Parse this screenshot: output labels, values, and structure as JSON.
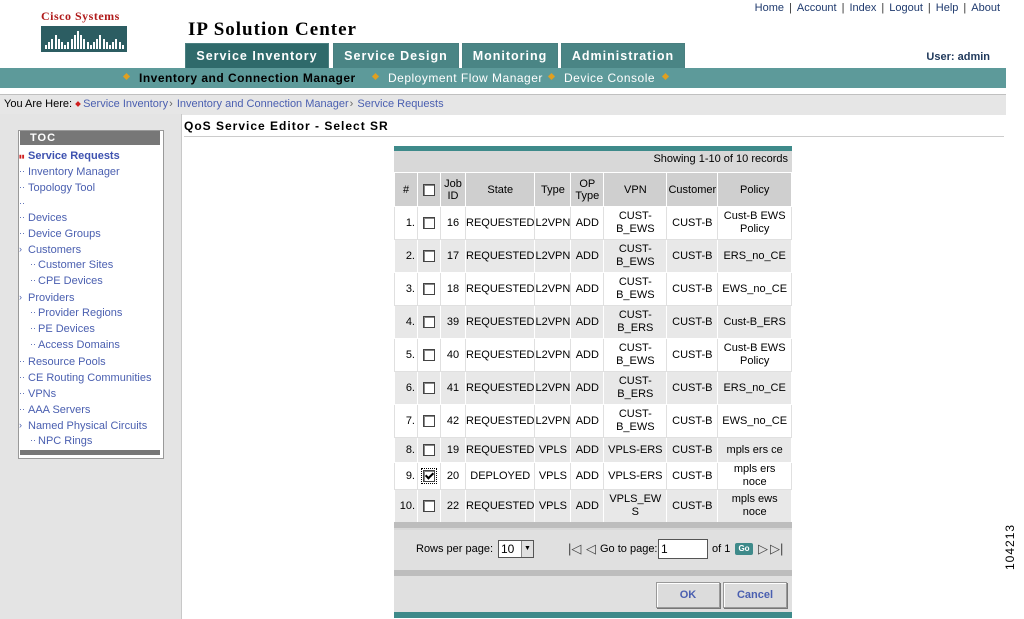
{
  "brand": {
    "logo_text": "Cisco Systems",
    "app_title": "IP Solution Center"
  },
  "top_links": [
    "Home",
    "Account",
    "Index",
    "Logout",
    "Help",
    "About"
  ],
  "user": {
    "label": "User: admin"
  },
  "tabs": [
    {
      "label": "Service Inventory",
      "active": true
    },
    {
      "label": "Service Design",
      "active": false
    },
    {
      "label": "Monitoring",
      "active": false
    },
    {
      "label": "Administration",
      "active": false
    }
  ],
  "subnav": [
    {
      "label": "Inventory and Connection Manager",
      "active": true
    },
    {
      "label": "Deployment Flow Manager",
      "active": false
    },
    {
      "label": "Device Console",
      "active": false
    }
  ],
  "breadcrumb": {
    "prefix": "You Are Here:",
    "items": [
      "Service Inventory",
      "Inventory and Connection Manager",
      "Service Requests"
    ]
  },
  "toc": {
    "title": "TOC",
    "items": [
      {
        "label": "Service Requests",
        "active": true
      },
      {
        "label": "Inventory Manager"
      },
      {
        "label": "Topology Tool"
      },
      {
        "label": ""
      },
      {
        "label": "Devices"
      },
      {
        "label": "Device Groups"
      },
      {
        "label": "Customers"
      },
      {
        "label": "Customer Sites"
      },
      {
        "label": "CPE Devices"
      },
      {
        "label": "Providers"
      },
      {
        "label": "Provider Regions"
      },
      {
        "label": "PE Devices"
      },
      {
        "label": "Access Domains"
      },
      {
        "label": "Resource Pools"
      },
      {
        "label": "CE Routing Communities"
      },
      {
        "label": "VPNs"
      },
      {
        "label": "AAA Servers"
      },
      {
        "label": "Named Physical Circuits"
      },
      {
        "label": "NPC Rings"
      }
    ]
  },
  "main": {
    "title": "QoS Service Editor - Select SR",
    "records_text": "Showing 1-10 of 10 records",
    "columns": [
      "#",
      "",
      "Job ID",
      "State",
      "Type",
      "OP Type",
      "VPN",
      "Customer",
      "Policy"
    ],
    "rows": [
      {
        "n": "1.",
        "checked": false,
        "job": "16",
        "state": "REQUESTED",
        "type": "L2VPN",
        "op": "ADD",
        "vpn": "CUST-B_EWS",
        "customer": "CUST-B",
        "policy": "Cust-B EWS Policy"
      },
      {
        "n": "2.",
        "checked": false,
        "job": "17",
        "state": "REQUESTED",
        "type": "L2VPN",
        "op": "ADD",
        "vpn": "CUST-B_EWS",
        "customer": "CUST-B",
        "policy": "ERS_no_CE"
      },
      {
        "n": "3.",
        "checked": false,
        "job": "18",
        "state": "REQUESTED",
        "type": "L2VPN",
        "op": "ADD",
        "vpn": "CUST-B_EWS",
        "customer": "CUST-B",
        "policy": "EWS_no_CE"
      },
      {
        "n": "4.",
        "checked": false,
        "job": "39",
        "state": "REQUESTED",
        "type": "L2VPN",
        "op": "ADD",
        "vpn": "CUST-B_ERS",
        "customer": "CUST-B",
        "policy": "Cust-B_ERS"
      },
      {
        "n": "5.",
        "checked": false,
        "job": "40",
        "state": "REQUESTED",
        "type": "L2VPN",
        "op": "ADD",
        "vpn": "CUST-B_EWS",
        "customer": "CUST-B",
        "policy": "Cust-B EWS Policy"
      },
      {
        "n": "6.",
        "checked": false,
        "job": "41",
        "state": "REQUESTED",
        "type": "L2VPN",
        "op": "ADD",
        "vpn": "CUST-B_ERS",
        "customer": "CUST-B",
        "policy": "ERS_no_CE"
      },
      {
        "n": "7.",
        "checked": false,
        "job": "42",
        "state": "REQUESTED",
        "type": "L2VPN",
        "op": "ADD",
        "vpn": "CUST-B_EWS",
        "customer": "CUST-B",
        "policy": "EWS_no_CE"
      },
      {
        "n": "8.",
        "checked": false,
        "job": "19",
        "state": "REQUESTED",
        "type": "VPLS",
        "op": "ADD",
        "vpn": "VPLS-ERS",
        "customer": "CUST-B",
        "policy": "mpls ers ce"
      },
      {
        "n": "9.",
        "checked": true,
        "job": "20",
        "state": "DEPLOYED",
        "type": "VPLS",
        "op": "ADD",
        "vpn": "VPLS-ERS",
        "customer": "CUST-B",
        "policy": "mpls ers noce"
      },
      {
        "n": "10.",
        "checked": false,
        "job": "22",
        "state": "REQUESTED",
        "type": "VPLS",
        "op": "ADD",
        "vpn": "VPLS_EWS",
        "customer": "CUST-B",
        "policy": "mpls ews noce"
      }
    ],
    "pager": {
      "rows_label": "Rows per page:",
      "rows_value": "10",
      "goto_label": "Go to page:",
      "goto_value": "1",
      "of_label": "of 1",
      "go_label": "Go"
    },
    "buttons": {
      "ok": "OK",
      "cancel": "Cancel"
    }
  },
  "figure_id": "104213"
}
